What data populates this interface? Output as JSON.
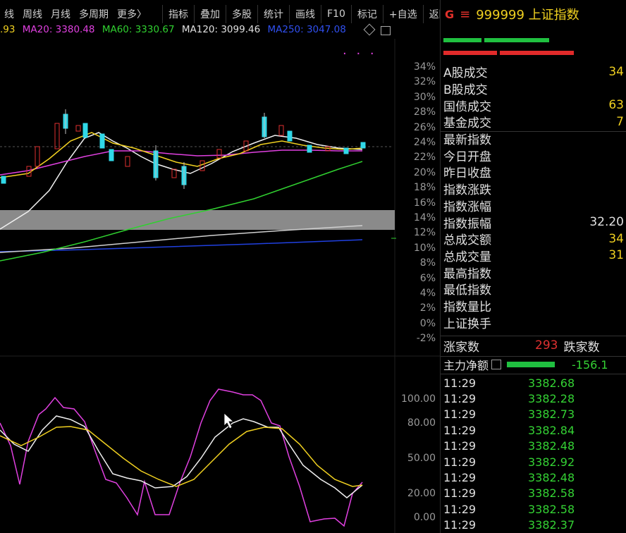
{
  "toolbar": {
    "left_items": [
      "线",
      "周线",
      "月线",
      "多周期",
      "更多〉"
    ],
    "right_items": [
      "指标",
      "叠加",
      "多股",
      "统计",
      "画线",
      "F10",
      "标记",
      "+自选",
      "返回"
    ]
  },
  "ma_legend": {
    "ma10": ".93",
    "ma20": "MA20: 3380.48",
    "ma60": "MA60: 3330.67",
    "ma120": "MA120: 3099.46",
    "ma250": "MA250: 3047.08",
    "colors": {
      "ma10": "#f0d020",
      "ma20": "#e040e0",
      "ma60": "#30d030",
      "ma120": "#e0e0e0",
      "ma250": "#3050f0"
    }
  },
  "chart_data": [
    {
      "type": "line",
      "title": "",
      "y_axis_labels": [
        "34%",
        "32%",
        "30%",
        "28%",
        "26%",
        "24%",
        "22%",
        "20%",
        "18%",
        "16%",
        "14%",
        "12%",
        "10%",
        "8%",
        "6%",
        "4%",
        "2%",
        "0%",
        "-2%"
      ]
    },
    {
      "type": "line",
      "title": "",
      "y_axis_labels": [
        "100.00",
        "80.00",
        "50.00",
        "20.00",
        "0.00"
      ]
    }
  ],
  "panel": {
    "g_label": "G",
    "eq_label": "≡",
    "code": "999999 上证指数",
    "info_rows": [
      {
        "label": "A股成交",
        "value": "34"
      },
      {
        "label": "B股成交",
        "value": ""
      },
      {
        "label": "国债成交",
        "value": "63"
      },
      {
        "label": "基金成交",
        "value": "7"
      },
      {
        "label": "最新指数",
        "value": ""
      },
      {
        "label": "今日开盘",
        "value": ""
      },
      {
        "label": "昨日收盘",
        "value": ""
      },
      {
        "label": "指数涨跌",
        "value": ""
      },
      {
        "label": "指数涨幅",
        "value": ""
      },
      {
        "label": "指数振幅",
        "value": "32.20"
      },
      {
        "label": "总成交额",
        "value": "34"
      },
      {
        "label": "总成交量",
        "value": "31"
      },
      {
        "label": "最高指数",
        "value": ""
      },
      {
        "label": "最低指数",
        "value": ""
      },
      {
        "label": "指数量比",
        "value": ""
      },
      {
        "label": "上证换手",
        "value": ""
      }
    ],
    "up_label": "涨家数",
    "up_value": "293",
    "down_label": "跌家数",
    "flow_label": "主力净额",
    "flow_value": "-156.1",
    "ticks": [
      {
        "time": "11:29",
        "price": "3382.68"
      },
      {
        "time": "11:29",
        "price": "3382.28"
      },
      {
        "time": "11:29",
        "price": "3382.73"
      },
      {
        "time": "11:29",
        "price": "3382.84"
      },
      {
        "time": "11:29",
        "price": "3382.48"
      },
      {
        "time": "11:29",
        "price": "3382.92"
      },
      {
        "time": "11:29",
        "price": "3382.48"
      },
      {
        "time": "11:29",
        "price": "3382.58"
      },
      {
        "time": "11:29",
        "price": "3382.58"
      },
      {
        "time": "11:29",
        "price": "3382.37"
      }
    ]
  }
}
